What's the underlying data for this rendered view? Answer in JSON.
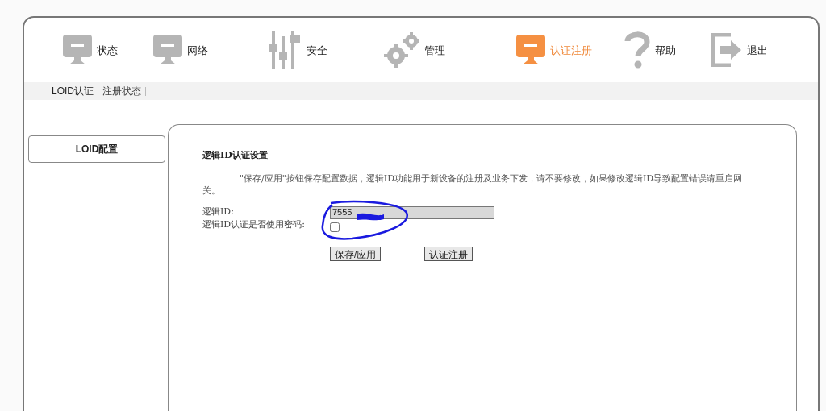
{
  "nav": [
    {
      "label": "状态",
      "kind": "monitor",
      "selected": false
    },
    {
      "label": "网络",
      "kind": "monitor",
      "selected": false
    },
    {
      "label": "安全",
      "kind": "sliders",
      "selected": false
    },
    {
      "label": "管理",
      "kind": "gears",
      "selected": false
    },
    {
      "label": "认证注册",
      "kind": "monitor",
      "selected": true
    },
    {
      "label": "帮助",
      "kind": "question",
      "selected": false
    },
    {
      "label": "退出",
      "kind": "exit",
      "selected": false
    }
  ],
  "subnav": [
    {
      "label": "LOID认证",
      "selected": true
    },
    {
      "label": "注册状态",
      "selected": false
    }
  ],
  "sidebar": {
    "items": [
      {
        "label": "LOID配置",
        "selected": true
      }
    ]
  },
  "form": {
    "title": "逻辑ID认证设置",
    "note": "\"保存/应用\"按钮保存配置数据，逻辑ID功能用于新设备的注册及业务下发，请不要修改，如果修改逻辑ID导致配置错误请重启网关。",
    "fields": [
      {
        "label": "逻辑ID:",
        "kind": "text",
        "value": "7555"
      },
      {
        "label": "逻辑ID认证是否使用密码:",
        "kind": "checkbox",
        "checked": false
      }
    ],
    "buttons": [
      "保存/应用",
      "认证注册"
    ]
  }
}
